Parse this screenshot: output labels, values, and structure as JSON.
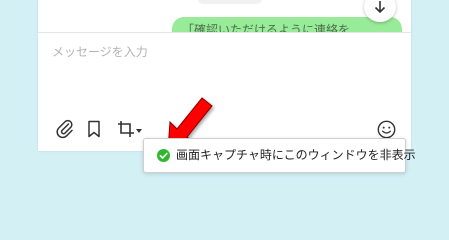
{
  "chat": {
    "message_bubble_text": "「確認いただけるように連絡を..."
  },
  "input": {
    "placeholder": "メッセージを入力"
  },
  "toolbar": {
    "icons": [
      "attach-icon",
      "bookmark-icon",
      "crop-icon",
      "emoji-icon"
    ]
  },
  "tooltip": {
    "label": "画面キャプチャ時にこのウィンドウを非表示",
    "checked": true
  },
  "colors": {
    "background": "#d3f0f5",
    "bubble": "#98eb98",
    "check": "#2eb82e",
    "arrow": "#ff0000"
  }
}
